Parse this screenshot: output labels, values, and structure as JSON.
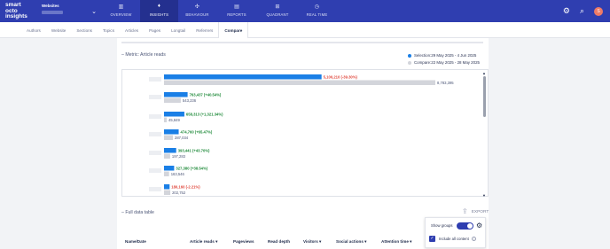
{
  "app": {
    "logo": [
      "smart",
      "octo",
      "insights"
    ],
    "site_label": "Websites"
  },
  "nav": [
    {
      "label": "OVERVIEW",
      "icon": "bar-chart-icon",
      "glyph": "▥"
    },
    {
      "label": "INSIGHTS",
      "icon": "bulb-icon",
      "glyph": "♦",
      "active": true
    },
    {
      "label": "BEHAVIOUR",
      "icon": "behaviour-icon",
      "glyph": "✣"
    },
    {
      "label": "REPORTS",
      "icon": "reports-icon",
      "glyph": "▤"
    },
    {
      "label": "QUADRANT",
      "icon": "quadrant-icon",
      "glyph": "⊞"
    },
    {
      "label": "REAL TIME",
      "icon": "realtime-icon",
      "glyph": "◷"
    }
  ],
  "nav_right": {
    "avatar_initial": "S"
  },
  "tabs": [
    "Authors",
    "Website",
    "Sections",
    "Topics",
    "Articles",
    "Pages",
    "Longtail",
    "Referrers",
    "Compare"
  ],
  "active_tab": "Compare",
  "metric_title": "– Metric: Article reads",
  "legend": {
    "selection": "Selection:29 May 2025 - 4 Jun 2025",
    "compare": "Compare:22 May 2025 - 28 May 2025"
  },
  "colors": {
    "selection": "#1a7fe6",
    "compare": "#d3d5db",
    "positive": "#1f8a3a",
    "negative": "#e0463b"
  },
  "chart_data": {
    "type": "bar",
    "orientation": "horizontal",
    "series": [
      {
        "name": "Selection",
        "values": [
          5100210,
          763437,
          658313,
          474760,
          393441,
          327380,
          180160
        ]
      },
      {
        "name": "Compare",
        "values": [
          8783395,
          543236,
          45849,
          287034,
          197283,
          163546,
          202752
        ]
      }
    ],
    "selection_labels": [
      "5,100,210 (-39.30%)",
      "763,437 (+40.54%)",
      "658,313 (+1,321.34%)",
      "474,760 (+65.47%)",
      "393,441 (+43.70%)",
      "327,380 (+38.54%)",
      "180,160 (-2.21%)"
    ],
    "compare_labels": [
      "8,783,395",
      "543,236",
      "45,849",
      "287,034",
      "197,283",
      "163,546",
      "202,752"
    ],
    "change_sign": [
      "neg",
      "pos",
      "pos",
      "pos",
      "pos",
      "pos",
      "neg"
    ],
    "xlim": [
      0,
      8783395
    ]
  },
  "full_table_title": "– Full data table",
  "export_label": "EXPORT",
  "popup": {
    "show_groups": "Show groups",
    "include_all": "Include all content"
  },
  "table_headers": [
    "Name/Date",
    "Article reads ▾",
    "Pageviews",
    "Read depth",
    "Visitors ▾",
    "Social actions ▾",
    "Attention time ▾"
  ]
}
